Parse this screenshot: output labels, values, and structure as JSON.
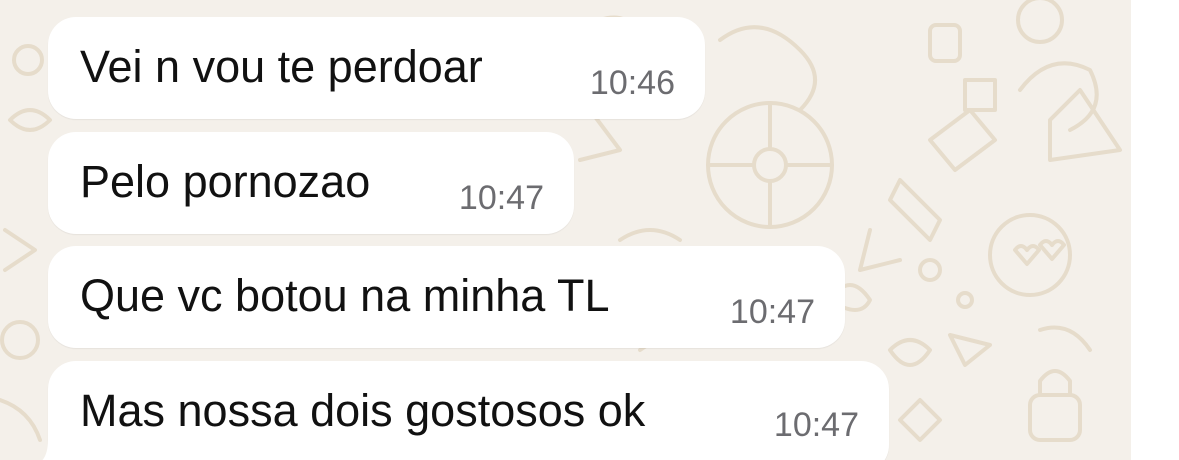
{
  "messages": [
    {
      "text": "Vei n vou te perdoar",
      "time": "10:46"
    },
    {
      "text": "Pelo pornozao",
      "time": "10:47"
    },
    {
      "text": "Que vc botou na minha TL",
      "time": "10:47"
    },
    {
      "text": "Mas nossa dois gostosos ok",
      "time": "10:47"
    }
  ],
  "colors": {
    "chat_background": "#f4f0ea",
    "wallpaper_doodles": "#e6dccb",
    "bubble": "#ffffff",
    "message_text": "#111111",
    "timestamp": "#6c6c70"
  }
}
